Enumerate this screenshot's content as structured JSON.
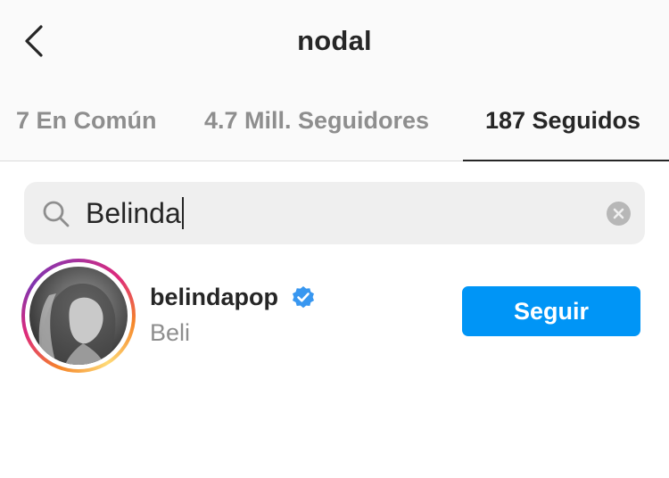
{
  "header": {
    "title": "nodal",
    "back_icon": "chevron-left-icon"
  },
  "tabs": [
    {
      "label": "7 En Común",
      "active": false
    },
    {
      "label": "4.7 Mill. Seguidores",
      "active": false
    },
    {
      "label": "187 Seguidos",
      "active": true
    }
  ],
  "search": {
    "icon": "search-icon",
    "value": "Belinda",
    "clear_icon": "clear-icon"
  },
  "results": [
    {
      "username": "belindapop",
      "verified": true,
      "full_name": "Beli",
      "button_label": "Seguir"
    }
  ],
  "colors": {
    "accent": "#0095f6",
    "verified": "#3897f0",
    "text_primary": "#262626",
    "text_secondary": "#8e8e8e",
    "search_bg": "#efefef",
    "header_bg": "#fafafa"
  }
}
